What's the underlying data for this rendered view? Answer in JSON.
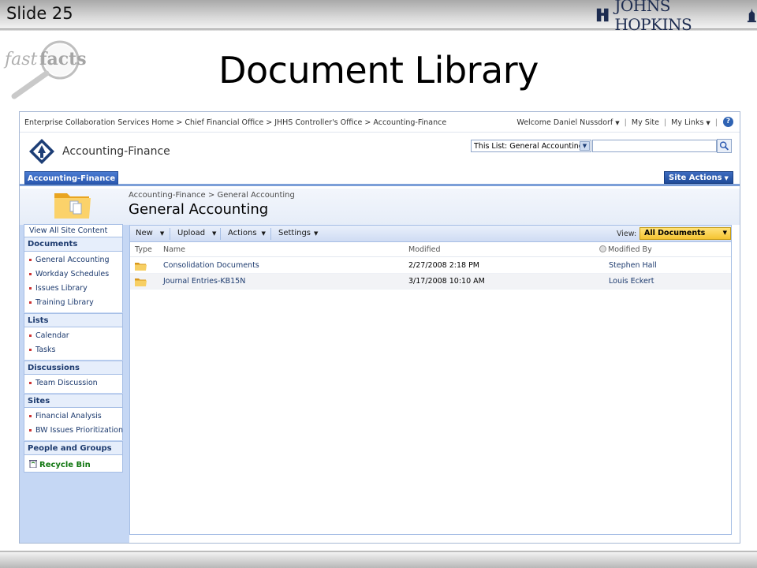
{
  "slide": {
    "number_label": "Slide 25",
    "title": "Document Library",
    "logo_text": "JOHNS HOPKINS",
    "badge_text": "fast facts"
  },
  "topbar": {
    "breadcrumb": "Enterprise Collaboration Services Home > Chief Financial Office > JHHS Controller's Office > Accounting-Finance",
    "welcome": "Welcome Daniel Nussdorf",
    "my_site": "My Site",
    "my_links": "My Links",
    "separator": "|",
    "help_icon": "help-icon"
  },
  "header": {
    "site_name": "Accounting-Finance",
    "search_scope": "This List: General Accounting",
    "search_value": "",
    "search_icon": "magnifier-icon"
  },
  "navbar": {
    "active_tab": "Accounting-Finance",
    "site_actions": "Site Actions"
  },
  "titlearea": {
    "breadcrumb": "Accounting-Finance > General Accounting",
    "title": "General Accounting"
  },
  "leftnav": {
    "view_all": "View All Site Content",
    "sections": [
      {
        "heading": "Documents",
        "items": [
          "General Accounting",
          "Workday Schedules",
          "Issues Library",
          "Training Library"
        ]
      },
      {
        "heading": "Lists",
        "items": [
          "Calendar",
          "Tasks"
        ]
      },
      {
        "heading": "Discussions",
        "items": [
          "Team Discussion"
        ]
      },
      {
        "heading": "Sites",
        "items": [
          "Financial Analysis",
          "BW Issues Prioritization"
        ]
      },
      {
        "heading": "People and Groups",
        "items": []
      }
    ],
    "recycle_bin": "Recycle Bin"
  },
  "toolbar": {
    "new": "New",
    "upload": "Upload",
    "actions": "Actions",
    "settings": "Settings",
    "view_label": "View:",
    "view_value": "All Documents"
  },
  "table": {
    "columns": {
      "type": "Type",
      "name": "Name",
      "modified": "Modified",
      "modified_by": "Modified By"
    },
    "rows": [
      {
        "name": "Consolidation Documents",
        "modified": "2/27/2008 2:18 PM",
        "modified_by": "Stephen Hall"
      },
      {
        "name": "Journal Entries-KB15N",
        "modified": "3/17/2008 10:10 AM",
        "modified_by": "Louis Eckert"
      }
    ]
  },
  "colors": {
    "accent_blue": "#2a58b0",
    "nav_light": "#c5d7f4",
    "view_select": "#f5c431",
    "link": "#1c3a6e",
    "recycle_green": "#117711"
  }
}
